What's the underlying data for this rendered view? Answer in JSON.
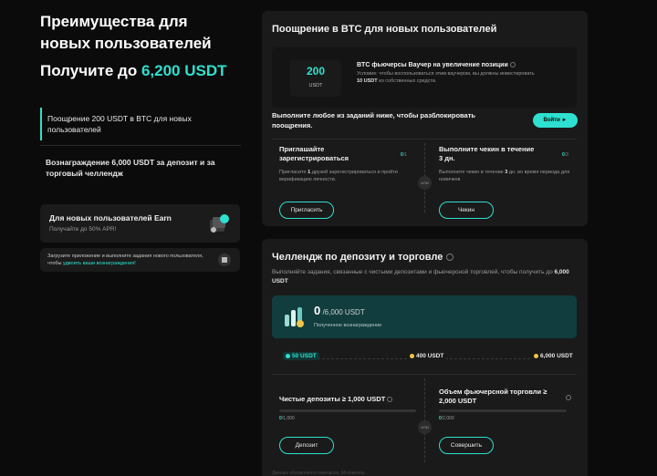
{
  "left": {
    "title": "Преимущества для новых пользователей",
    "subtitle_prefix": "Получите до ",
    "subtitle_amount": "6,200 USDT",
    "nav": [
      {
        "label": "Поощрение 200 USDT в BTC для новых пользователей",
        "active": true
      },
      {
        "label": "Вознаграждение 6,000 USDT за депозит и за торговый челлендж",
        "active": false
      }
    ],
    "earn_card": {
      "title": "Для новых пользователей Earn",
      "subtitle": "Получайте до 50% APR!"
    },
    "app_card": {
      "text": "Загрузите приложение и выполните задания нового пользователя, чтобы ",
      "link": "удвоить ваши вознаграждения!"
    }
  },
  "panel1": {
    "title": "Поощрение в BTC для новых пользователей",
    "voucher": {
      "amount": "200",
      "unit": "USDT",
      "title": "BTC фьючерсы Ваучер на увеличение позиции",
      "desc_pre": "Условие: чтобы воспользоваться этим ваучером, вы должны инвестировать ",
      "desc_bold": "10 USDT",
      "desc_post": " из собственных средств."
    },
    "unlock_text": "Выполните любое из заданий ниже, чтобы разблокировать поощрения.",
    "login_button": "Войти ►",
    "or": "ИЛИ",
    "tasks": [
      {
        "title": "Приглашайте зарегистрироваться",
        "progress_done": "0",
        "progress_total": "/1",
        "desc_pre": "Пригласите ",
        "desc_bold": "1",
        "desc_post": " друзей зарегистрироваться и пройти верификацию личности.",
        "button": "Пригласить"
      },
      {
        "title": "Выполните чекин в течение 3 дн.",
        "progress_done": "0",
        "progress_total": "/3",
        "desc_pre": "Выполните чекин в течение ",
        "desc_bold": "3",
        "desc_post": " дн. во время периода для новичков",
        "button": "Чекин"
      }
    ]
  },
  "panel2": {
    "title": "Челлендж по депозиту и торговле",
    "desc_pre": "Выполняйте задания, связанные с чистыми депозитами и фьючерсной торговлей, чтобы получить до ",
    "desc_bold": "6,000 USDT",
    "reward": {
      "amount": "0",
      "of": " /6,000 USDT",
      "label": "Полученное вознаграждение"
    },
    "milestones": [
      "50 USDT",
      "400 USDT",
      "6,000 USDT"
    ],
    "tasks": [
      {
        "title": "Чистые депозиты ≥ 1,000 USDT",
        "progress_done": "0",
        "progress_total": "/1,000",
        "button": "Депозит"
      },
      {
        "title": "Объем фьючерсной торговли ≥ 2,000 USDT",
        "progress_done": "0",
        "progress_total": "/2,000",
        "button": "Совершить"
      }
    ],
    "footnote": "Данные обновляются ежечасно. Мгновенно."
  },
  "colors": {
    "accent": "#2ee0cf",
    "background": "#0b0b0b",
    "panel": "#1a1a1a",
    "reward_bg": "#113d3e",
    "coin": "#f3c34a"
  }
}
